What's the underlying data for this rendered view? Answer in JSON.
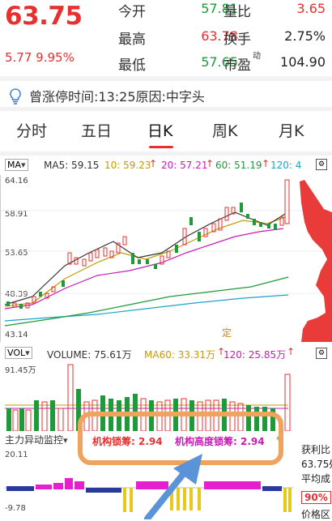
{
  "quote": {
    "price": "63.75",
    "change": "5.77 9.95%",
    "rows": [
      {
        "label1": "今开",
        "val1": "57.81",
        "c1": "green",
        "label2": "量比",
        "val2": "3.65",
        "c2": "red"
      },
      {
        "label1": "最高",
        "val1": "63.78",
        "c1": "red",
        "label2": "换手",
        "val2": "2.75%",
        "c2": "dark"
      },
      {
        "label1": "最低",
        "val1": "57.65",
        "c1": "green",
        "label2": "市盈",
        "sup2": "动",
        "val2": "104.90",
        "c2": "dark"
      }
    ]
  },
  "limit_info": "曾涨停时间:13:25原因:中字头",
  "tabs": [
    "分时",
    "五日",
    "日K",
    "周K",
    "月K"
  ],
  "active_tab": "日K",
  "ma_bar": {
    "selector": "MA",
    "ma5": "MA5: 59.15",
    "ma10": "10: 59.23",
    "ma20": "20: 57.21",
    "ma60": "60: 51.19",
    "ma120": "120: 4"
  },
  "price_axis": [
    "64.16",
    "58.91",
    "53.65",
    "48.39",
    "43.14"
  ],
  "chart_marker": "定",
  "vol_bar": {
    "selector": "VOL",
    "volume": "VOLUME: 75.61万",
    "ma60": "MA60: 33.31万",
    "ma120": "120: 25.85万"
  },
  "vol_axis": "91.45万",
  "funds_bar": {
    "selector": "主力异动监控",
    "item1": "机构锁筹: 2.94",
    "item2": "机构高度锁筹: 2.94"
  },
  "funds_axis_top": "20.11",
  "funds_axis_bottom": "-9.78",
  "side_panel": {
    "l1": "获利比",
    "l2": "63.75処",
    "l3": "平均成",
    "badge": "90%",
    "l5": "价格区"
  },
  "colors": {
    "up": "#e8312f",
    "down": "#1e9a3a",
    "annot": "#f0a35c",
    "arrow": "#5a93d8"
  }
}
